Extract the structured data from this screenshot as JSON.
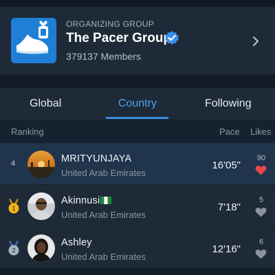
{
  "group": {
    "label": "ORGANIZING GROUP",
    "name": "The Pacer Group",
    "members": "379137 Members",
    "logo_icon": "pacer-app-logo-icon",
    "verified_icon": "verified-badge-icon"
  },
  "tabs": [
    {
      "label": "Global",
      "active": false
    },
    {
      "label": "Country",
      "active": true
    },
    {
      "label": "Following",
      "active": false
    }
  ],
  "columns": {
    "ranking": "Ranking",
    "pace": "Pace",
    "likes": "Likes"
  },
  "rows": [
    {
      "rank": "4",
      "name": "MRITYUNJAYA",
      "country": "United Arab Emirates",
      "pace": "16'05\"",
      "likes": "90",
      "liked": true
    },
    {
      "rank": "1",
      "name": "Akinnusi",
      "flag": "nigeria-flag-icon",
      "country": "United Arab Emirates",
      "pace": "7'18\"",
      "likes": "5",
      "liked": false
    },
    {
      "rank": "2",
      "name": "Ashley",
      "country": "United Arab Emirates",
      "pace": "12'16\"",
      "likes": "6",
      "liked": false
    }
  ],
  "colors": {
    "accent": "#4ba3f0",
    "liked_heart": "#e8464a",
    "unliked_heart": "#8a939e",
    "gold_medal": "#f2b51f",
    "silver_medal": "#a9b4c2"
  }
}
